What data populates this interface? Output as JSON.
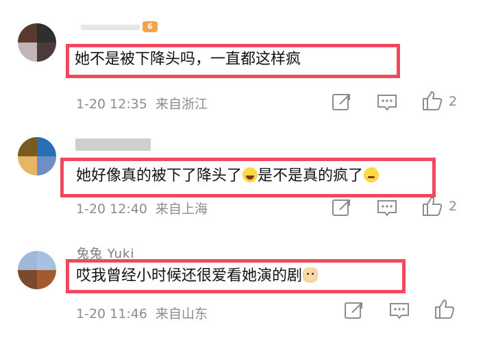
{
  "comments": [
    {
      "text": "她不是被下降头吗，一直都这样疯",
      "time": "1-20 12:35",
      "location": "来自浙江",
      "likes": "2",
      "avatar_colors": [
        "#5a3a2f",
        "#2f2f2f",
        "#c0b6b6",
        "#4b3b3b"
      ],
      "badge_icon": "vip-badge-icon"
    },
    {
      "text_part1": "她好像真的被下了降头了",
      "text_part2": "是不是真的疯了",
      "emoji1": "laughing-crying-emoji-icon",
      "emoji2": "crazy-face-emoji-icon",
      "time": "1-20 12:40",
      "location": "来自上海",
      "likes": "2",
      "avatar_colors": [
        "#7a5a1e",
        "#2a6fb1",
        "#e8b566",
        "#6f8fc4"
      ]
    },
    {
      "username": "兔兔 Yuki",
      "text": "哎我曾经小时候还很爱看她演的剧",
      "emoji": "dog-emoji-icon",
      "time": "1-20 11:46",
      "location": "来自山东",
      "likes": "",
      "avatar_colors": [
        "#9fb7d9",
        "#a7c1e0",
        "#7a4a2a",
        "#a35a2f"
      ]
    }
  ],
  "icons": {
    "repost": "repost-icon",
    "comment": "comment-icon",
    "like": "thumbs-up-icon"
  },
  "colors": {
    "highlight_box": "#f0485d",
    "meta_text": "#8c8c8c"
  }
}
